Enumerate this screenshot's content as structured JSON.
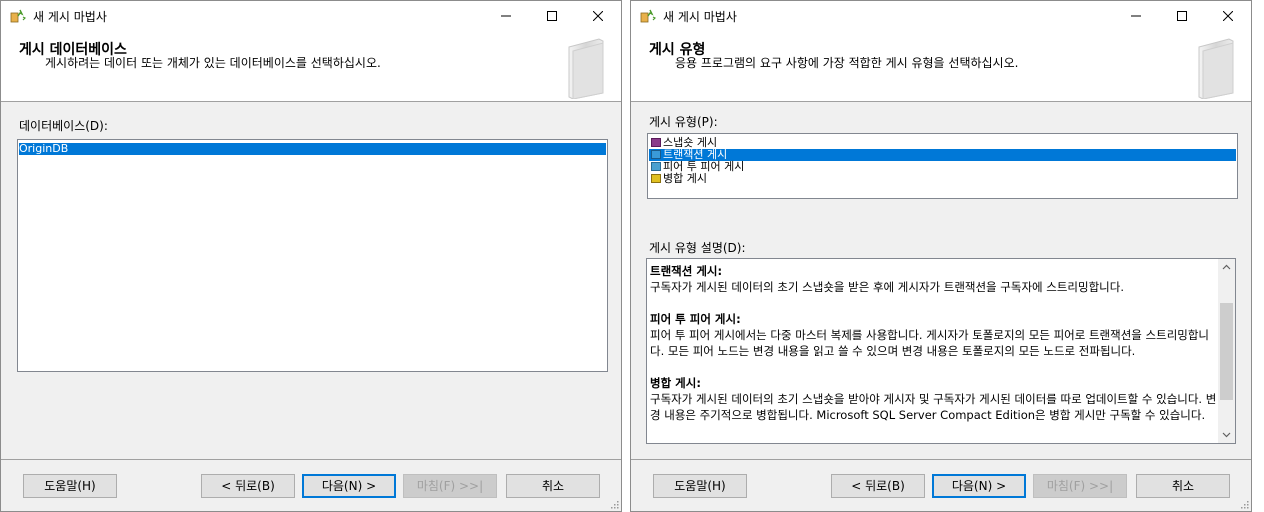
{
  "windows": [
    {
      "title": "새 게시 마법사",
      "header": {
        "title": "게시 데이터베이스",
        "description": "게시하려는 데이터 또는 개체가 있는 데이터베이스를 선택하십시오."
      },
      "database_label": "데이터베이스(D):",
      "databases": [
        "OriginDB"
      ],
      "selected_database": "OriginDB",
      "buttons": {
        "help": "도움말(H)",
        "back": "< 뒤로(B)",
        "next": "다음(N) >",
        "finish": "마침(F) >>|",
        "cancel": "취소"
      }
    },
    {
      "title": "새 게시 마법사",
      "header": {
        "title": "게시 유형",
        "description": "응용 프로그램의 요구 사항에 가장 적합한 게시 유형을 선택하십시오."
      },
      "type_label": "게시 유형(P):",
      "types": [
        {
          "label": "스냅숏 게시",
          "icon": "snapshot-publication-icon"
        },
        {
          "label": "트랜잭션 게시",
          "icon": "transactional-publication-icon"
        },
        {
          "label": "피어 투 피어 게시",
          "icon": "peer-to-peer-publication-icon"
        },
        {
          "label": "병합 게시",
          "icon": "merge-publication-icon"
        }
      ],
      "selected_type": "트랜잭션 게시",
      "description_label": "게시 유형 설명(D):",
      "descriptions": [
        {
          "title": "트랜잭션 게시:",
          "body": "구독자가 게시된 데이터의 초기 스냅숏을 받은 후에 게시자가 트랜잭션을 구독자에 스트리밍합니다."
        },
        {
          "title": "피어 투 피어 게시:",
          "body": "피어 투 피어 게시에서는 다중 마스터 복제를 사용합니다. 게시자가 토폴로지의 모든 피어로 트랜잭션을 스트리밍합니다. 모든 피어 노드는 변경 내용을 읽고 쓸 수 있으며 변경 내용은 토폴로지의 모든 노드로 전파됩니다."
        },
        {
          "title": "병합 게시:",
          "body": "구독자가 게시된 데이터의 초기 스냅숏을 받아야 게시자 및 구독자가 게시된 데이터를 따로 업데이트할 수 있습니다. 변경 내용은 주기적으로 병합됩니다. Microsoft SQL Server Compact Edition은 병합 게시만 구독할 수 있습니다."
        }
      ],
      "buttons": {
        "help": "도움말(H)",
        "back": "< 뒤로(B)",
        "next": "다음(N) >",
        "finish": "마침(F) >>|",
        "cancel": "취소"
      }
    }
  ],
  "colors": {
    "selection": "#0078d7",
    "dialog_bg": "#f0f0f0",
    "disabled_text": "#a0a0a0"
  }
}
